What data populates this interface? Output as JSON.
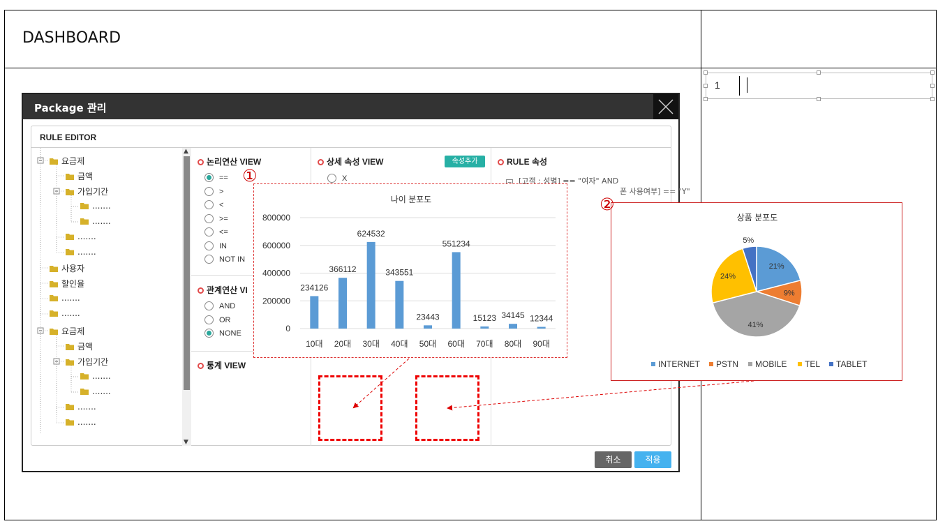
{
  "dashboard": {
    "title": "DASHBOARD"
  },
  "textbox": {
    "value": "1"
  },
  "modal": {
    "title": "Package 관리",
    "editor_title": "RULE EDITOR",
    "tree": [
      {
        "label": "요금제",
        "level": 0,
        "top": 18
      },
      {
        "label": "금액",
        "level": 1,
        "top": 40
      },
      {
        "label": "가입기간",
        "level": 1,
        "top": 62
      },
      {
        "label": ".......",
        "level": 2,
        "top": 84
      },
      {
        "label": ".......",
        "level": 2,
        "top": 106
      },
      {
        "label": ".......",
        "level": 1,
        "top": 128
      },
      {
        "label": ".......",
        "level": 1,
        "top": 150
      },
      {
        "label": "사용자",
        "level": 0,
        "top": 172
      },
      {
        "label": "할인율",
        "level": 0,
        "top": 194
      },
      {
        "label": ".......",
        "level": 0,
        "top": 216
      },
      {
        "label": ".......",
        "level": 0,
        "top": 238
      },
      {
        "label": "요금제",
        "level": 0,
        "top": 262
      },
      {
        "label": "금액",
        "level": 1,
        "top": 284
      },
      {
        "label": "가입기간",
        "level": 1,
        "top": 306
      },
      {
        "label": ".......",
        "level": 2,
        "top": 328
      },
      {
        "label": ".......",
        "level": 2,
        "top": 350
      },
      {
        "label": ".......",
        "level": 1,
        "top": 372
      },
      {
        "label": ".......",
        "level": 1,
        "top": 394
      }
    ],
    "logic_view": {
      "title": "논리연산 VIEW",
      "options": [
        "==",
        ">",
        "<",
        ">=",
        "<=",
        "IN",
        "NOT IN"
      ],
      "selected": 0
    },
    "relation_view": {
      "title": "관계연산 VI",
      "options": [
        "AND",
        "OR",
        "NONE"
      ],
      "selected": 2
    },
    "stats_view": {
      "title": "통계 VIEW"
    },
    "detail_view": {
      "title": "상세 속성 VIEW",
      "add_button": "속성추가",
      "option": "X"
    },
    "rule_attr": {
      "title": "RULE 속성",
      "line1": "[고객 : 성별] == \"여자\" AND",
      "line2": "폰 사용여부] == \"Y\""
    },
    "cancel_label": "취소",
    "apply_label": "적용"
  },
  "markers": {
    "one": "①",
    "two": "②"
  },
  "chart_data": [
    {
      "type": "bar",
      "title": "나이 분포도",
      "categories": [
        "10대",
        "20대",
        "30대",
        "40대",
        "50대",
        "60대",
        "70대",
        "80대",
        "90대"
      ],
      "values": [
        234126,
        366112,
        624532,
        343551,
        23443,
        551234,
        15123,
        34145,
        12344
      ],
      "ylim": [
        0,
        800000
      ],
      "yticks": [
        0,
        200000,
        400000,
        600000,
        800000
      ],
      "grid": true,
      "color": "#5b9bd5"
    },
    {
      "type": "pie",
      "title": "상품 분포도",
      "categories": [
        "INTERNET",
        "PSTN",
        "MOBILE",
        "TEL",
        "TABLET"
      ],
      "values": [
        21,
        9,
        41,
        24,
        5
      ],
      "labels": [
        "21%",
        "9%",
        "41%",
        "24%",
        "5%"
      ],
      "colors": [
        "#5b9bd5",
        "#ed7d31",
        "#a5a5a5",
        "#ffc000",
        "#4472c4"
      ],
      "legend": "bottom"
    }
  ]
}
